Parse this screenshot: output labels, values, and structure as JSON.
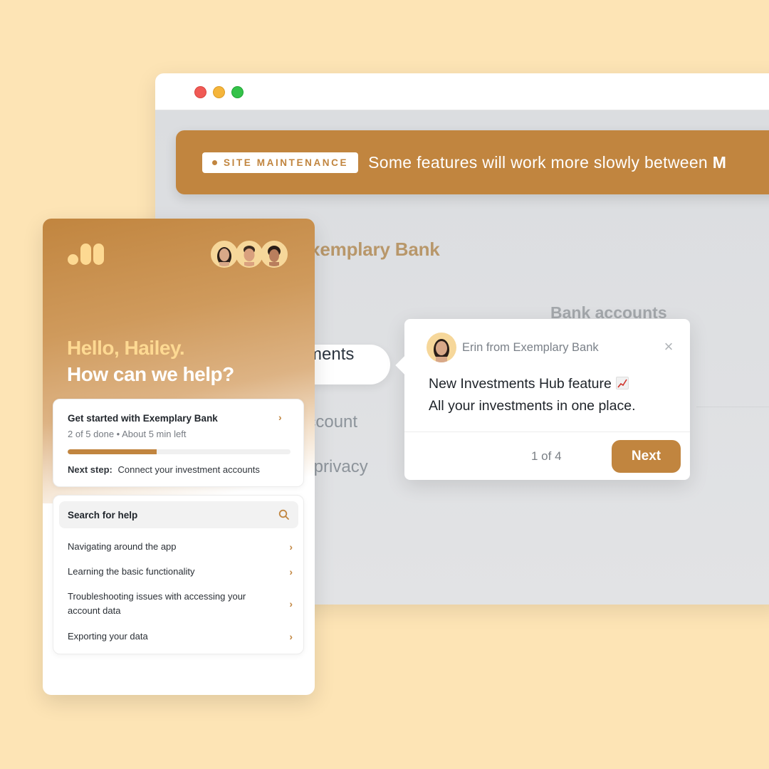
{
  "browser": {
    "controls": [
      "close",
      "minimize",
      "maximize"
    ]
  },
  "banner": {
    "badge_label": "SITE MAINTENANCE",
    "message": "Some features will work more slowly between ",
    "message_bold": "M",
    "color": "#c1853f"
  },
  "app": {
    "bank_name": "Exemplary Bank",
    "nav": {
      "bank_accounts": "Bank accounts",
      "investments_hub": "Investments Hub",
      "account": "account",
      "privacy": "& privacy"
    }
  },
  "tooltip": {
    "sender": "Erin from Exemplary Bank",
    "line1": "New Investments Hub feature",
    "line1_emoji": "chart-increasing",
    "line2": "All your investments in one place.",
    "progress": "1 of 4",
    "next_label": "Next",
    "close_icon": "×"
  },
  "messenger": {
    "greeting": "Hello, Hailey.",
    "prompt": "How can we help?",
    "avatars": [
      "team-member-1",
      "team-member-2",
      "team-member-3"
    ],
    "onboarding": {
      "title": "Get started with Exemplary Bank",
      "status": "2 of 5 done • About 5 min left",
      "done": 2,
      "total": 5,
      "progress_fraction": 0.4,
      "next_step_label": "Next step:",
      "next_step_value": "Connect your investment accounts"
    },
    "help": {
      "search_placeholder": "Search for help",
      "items": [
        "Navigating around the app",
        "Learning the basic functionality",
        "Troubleshooting issues with accessing your account data",
        "Exporting your data"
      ]
    }
  },
  "colors": {
    "accent": "#c1853f",
    "background": "#fde4b5",
    "greeting": "#fdd992"
  }
}
